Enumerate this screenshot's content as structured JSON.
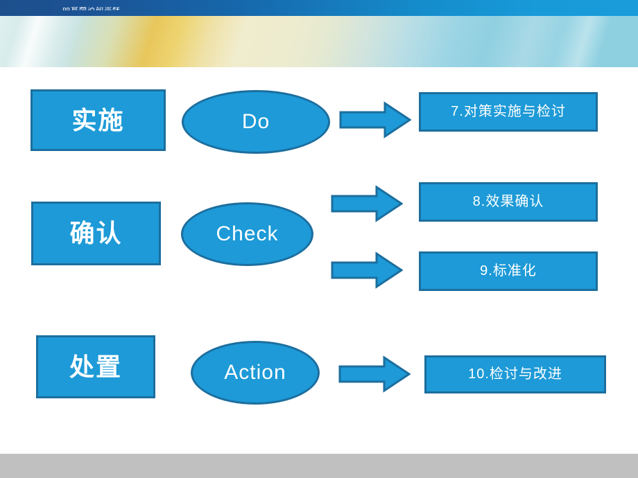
{
  "header": {
    "title_text": "品管圈活动流程",
    "bar_color_left": "#1d4f8c",
    "bar_color_right": "#1a9cda",
    "band_colors": [
      "#dfefee",
      "#e8c75c",
      "#f0ecce",
      "#8ed0e0"
    ]
  },
  "footer": {
    "color": "#c0c0c0"
  },
  "theme": {
    "shape_fill": "#1d9ad7",
    "shape_border": "#1c6e9e",
    "shape_text": "#ffffff",
    "arrow_fill": "#1d9ad7",
    "arrow_border": "#1c6e9e",
    "page_background": "#ffffff"
  },
  "diagram": {
    "type": "pdca-flow",
    "rows": [
      {
        "stage_label": "实施",
        "stage_english": "Do",
        "steps": [
          "7.对策实施与检讨"
        ]
      },
      {
        "stage_label": "确认",
        "stage_english": "Check",
        "steps": [
          "8.效果确认",
          "9.标准化"
        ]
      },
      {
        "stage_label": "处置",
        "stage_english": "Action",
        "steps": [
          "10.检讨与改进"
        ]
      }
    ]
  }
}
